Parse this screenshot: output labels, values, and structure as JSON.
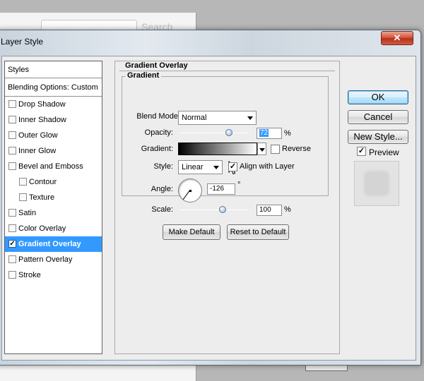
{
  "background": {
    "search_placeholder": "Search"
  },
  "dialog": {
    "title": "Layer Style",
    "close_label": "✕"
  },
  "styles_list": {
    "header": "Styles",
    "blending_options": "Blending Options: Custom",
    "items": [
      {
        "label": "Drop Shadow",
        "checked": false,
        "indent": false,
        "selected": false
      },
      {
        "label": "Inner Shadow",
        "checked": false,
        "indent": false,
        "selected": false
      },
      {
        "label": "Outer Glow",
        "checked": false,
        "indent": false,
        "selected": false
      },
      {
        "label": "Inner Glow",
        "checked": false,
        "indent": false,
        "selected": false
      },
      {
        "label": "Bevel and Emboss",
        "checked": false,
        "indent": false,
        "selected": false
      },
      {
        "label": "Contour",
        "checked": false,
        "indent": true,
        "selected": false
      },
      {
        "label": "Texture",
        "checked": false,
        "indent": true,
        "selected": false
      },
      {
        "label": "Satin",
        "checked": false,
        "indent": false,
        "selected": false
      },
      {
        "label": "Color Overlay",
        "checked": false,
        "indent": false,
        "selected": false
      },
      {
        "label": "Gradient Overlay",
        "checked": true,
        "indent": false,
        "selected": true
      },
      {
        "label": "Pattern Overlay",
        "checked": false,
        "indent": false,
        "selected": false
      },
      {
        "label": "Stroke",
        "checked": false,
        "indent": false,
        "selected": false
      }
    ]
  },
  "gradient_overlay": {
    "section_title": "Gradient Overlay",
    "group_title": "Gradient",
    "blend_mode_label": "Blend Mode:",
    "blend_mode_value": "Normal",
    "opacity_label": "Opacity:",
    "opacity_value": "72",
    "opacity_fraction": 0.72,
    "opacity_unit": "%",
    "gradient_label": "Gradient:",
    "reverse_label": "Reverse",
    "reverse_checked": false,
    "style_label": "Style:",
    "style_value": "Linear",
    "align_label": "Align with Layer",
    "align_checked": true,
    "angle_label": "Angle:",
    "angle_value": "-126",
    "angle_unit": "°",
    "scale_label": "Scale:",
    "scale_value": "100",
    "scale_unit": "%",
    "make_default_label": "Make Default",
    "reset_default_label": "Reset to Default"
  },
  "side_buttons": {
    "ok_label": "OK",
    "cancel_label": "Cancel",
    "new_style_label": "New Style...",
    "preview_label": "Preview",
    "preview_checked": true
  }
}
